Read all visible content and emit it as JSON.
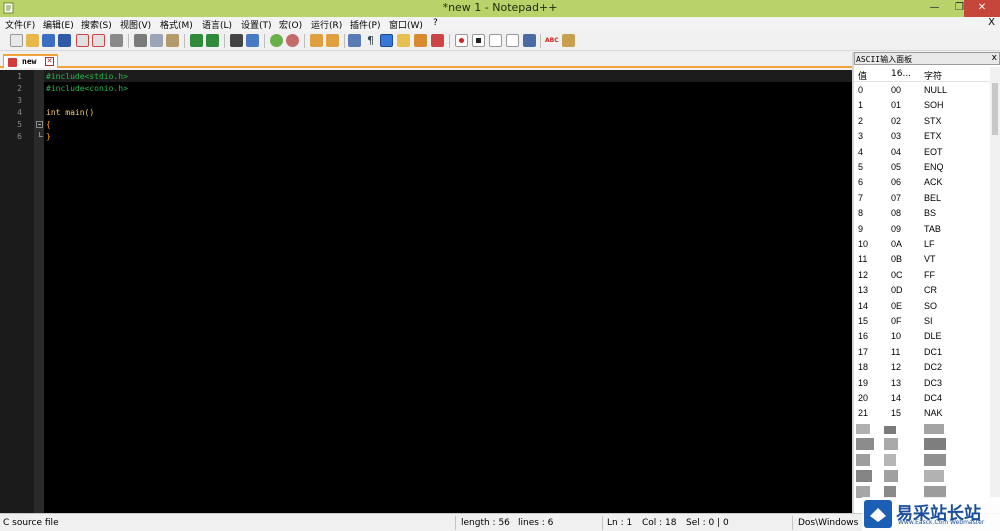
{
  "window": {
    "title": "*new  1 - Notepad++",
    "min_label": "—",
    "max_label": "❐",
    "close_label": "✕"
  },
  "menu": {
    "items": [
      {
        "label": "文件(F)"
      },
      {
        "label": "编辑(E)"
      },
      {
        "label": "搜索(S)"
      },
      {
        "label": "视图(V)"
      },
      {
        "label": "格式(M)"
      },
      {
        "label": "语言(L)"
      },
      {
        "label": "设置(T)"
      },
      {
        "label": "宏(O)"
      },
      {
        "label": "运行(R)"
      },
      {
        "label": "插件(P)"
      },
      {
        "label": "窗口(W)"
      },
      {
        "label": "?"
      }
    ],
    "close_label": "X"
  },
  "tab": {
    "label": "new",
    "close_label": "✕"
  },
  "editor": {
    "lines": [
      {
        "no": "1",
        "text": "#include<stdio.h>"
      },
      {
        "no": "2",
        "text": "#include<conio.h>"
      },
      {
        "no": "3",
        "text": ""
      },
      {
        "no": "4",
        "kw": "int",
        "fn": " main()"
      },
      {
        "no": "5",
        "text": "{"
      },
      {
        "no": "6",
        "text": "}"
      }
    ]
  },
  "ascii_panel": {
    "title": "ASCII输入面板",
    "close_label": "x",
    "col_value": "值",
    "col_hex": "16...",
    "col_char": "字符",
    "rows": [
      [
        "0",
        "00",
        "NULL"
      ],
      [
        "1",
        "01",
        "SOH"
      ],
      [
        "2",
        "02",
        "STX"
      ],
      [
        "3",
        "03",
        "ETX"
      ],
      [
        "4",
        "04",
        "EOT"
      ],
      [
        "5",
        "05",
        "ENQ"
      ],
      [
        "6",
        "06",
        "ACK"
      ],
      [
        "7",
        "07",
        "BEL"
      ],
      [
        "8",
        "08",
        "BS"
      ],
      [
        "9",
        "09",
        "TAB"
      ],
      [
        "10",
        "0A",
        "LF"
      ],
      [
        "11",
        "0B",
        "VT"
      ],
      [
        "12",
        "0C",
        "FF"
      ],
      [
        "13",
        "0D",
        "CR"
      ],
      [
        "14",
        "0E",
        "SO"
      ],
      [
        "15",
        "0F",
        "SI"
      ],
      [
        "16",
        "10",
        "DLE"
      ],
      [
        "17",
        "11",
        "DC1"
      ],
      [
        "18",
        "12",
        "DC2"
      ],
      [
        "19",
        "13",
        "DC3"
      ],
      [
        "20",
        "14",
        "DC4"
      ],
      [
        "21",
        "15",
        "NAK"
      ]
    ]
  },
  "status": {
    "file_type": "C source file",
    "length": "length : 56",
    "lines": "lines : 6",
    "ln": "Ln : 1",
    "col": "Col : 18",
    "sel": "Sel : 0 | 0",
    "eol": "Dos\\Windows"
  },
  "watermark": {
    "text": "易采站长站",
    "sub": "Www.Easck.Com Webmaster"
  },
  "colors": {
    "titlebar": "#b7d36a",
    "tab_accent": "#f2a33a",
    "editor_bg": "#000000",
    "preprocessor": "#27b84a",
    "keyword": "#ffcc66"
  }
}
